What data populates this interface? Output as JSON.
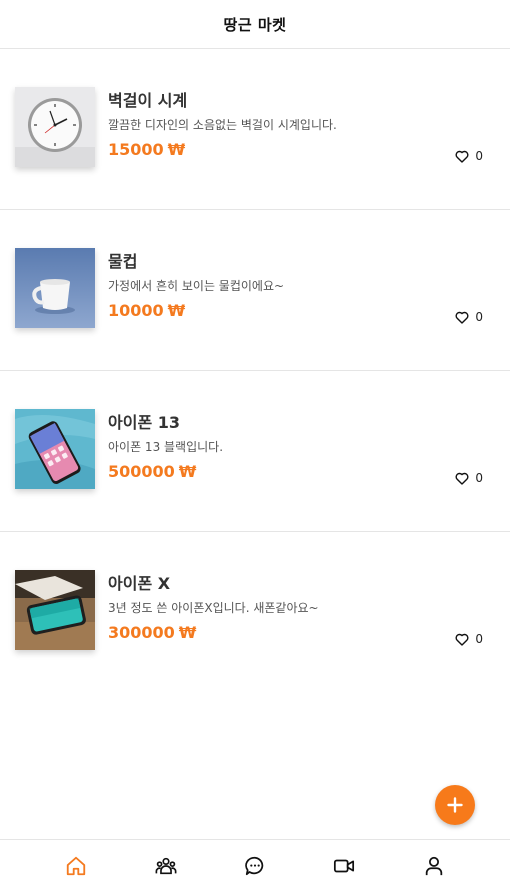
{
  "header": {
    "title": "땅근 마켓"
  },
  "items": [
    {
      "name": "벽걸이 시계",
      "description": "깔끔한 디자인의 소음없는 벽걸이 시계입니다.",
      "price": "15000",
      "currency": "₩",
      "likes": "0",
      "image": "wall-clock"
    },
    {
      "name": "물컵",
      "description": "가정에서 흔히 보이는 물컵이에요~",
      "price": "10000",
      "currency": "₩",
      "likes": "0",
      "image": "mug"
    },
    {
      "name": "아이폰 13",
      "description": "아이폰 13 블랙입니다.",
      "price": "500000",
      "currency": "₩",
      "likes": "0",
      "image": "iphone-13"
    },
    {
      "name": "아이폰 X",
      "description": "3년 정도 쓴 아이폰X입니다. 새폰같아요~",
      "price": "300000",
      "currency": "₩",
      "likes": "0",
      "image": "iphone-x"
    }
  ],
  "tabs": [
    {
      "name": "home-icon",
      "active": true
    },
    {
      "name": "community-icon",
      "active": false
    },
    {
      "name": "chat-icon",
      "active": false
    },
    {
      "name": "video-icon",
      "active": false
    },
    {
      "name": "profile-icon",
      "active": false
    }
  ],
  "colors": {
    "accent": "#f47a1f",
    "text": "#333333",
    "divider": "#e5e5e5"
  }
}
